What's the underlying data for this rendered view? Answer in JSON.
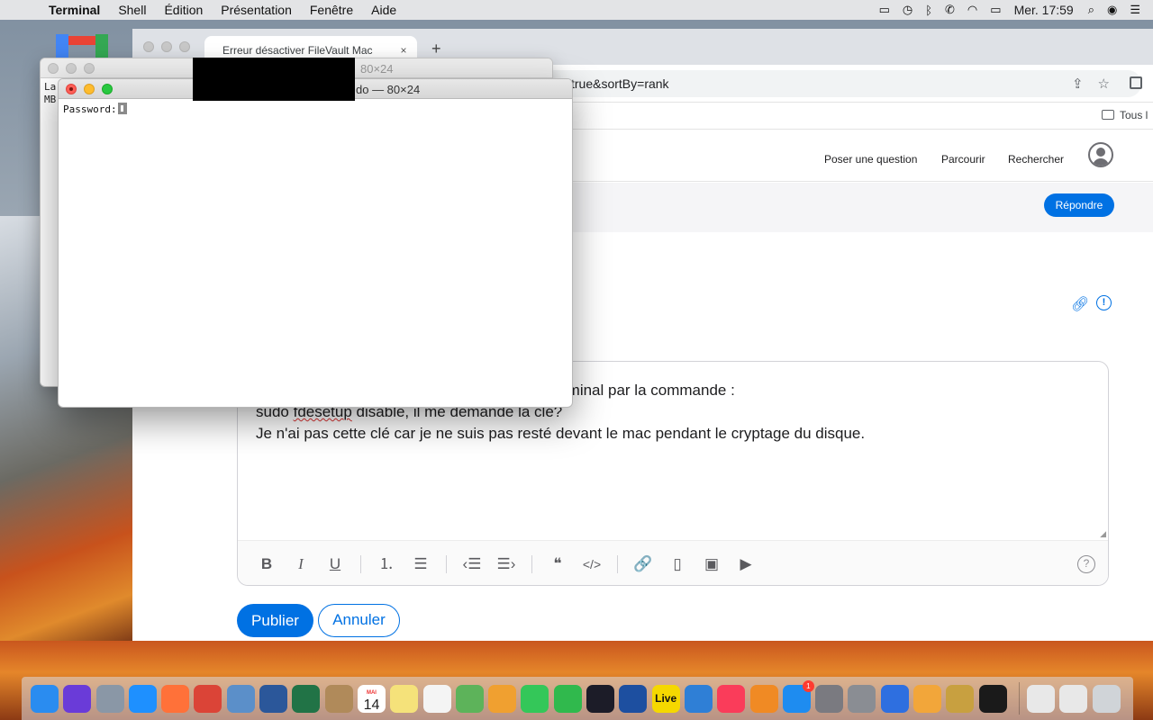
{
  "menubar": {
    "app": "Terminal",
    "items": [
      "Shell",
      "Édition",
      "Présentation",
      "Fenêtre",
      "Aide"
    ],
    "clock": "Mer. 17:59"
  },
  "browser": {
    "tab_title": "Erreur désactiver FileVault Mac",
    "tab_close": "×",
    "new_tab": "+",
    "url_visible": "true&sortBy=rank",
    "bookmarks_all": "Tous l",
    "nav": {
      "ask": "Poser une question",
      "browse": "Parcourir",
      "search": "Rechercher"
    },
    "reply_label": "Répondre"
  },
  "editor": {
    "line1": "rminal par la commande :",
    "line2_pre": "sudo ",
    "line2_typo": "fdesetup",
    "line2_post": " disable, il me demande la clé?",
    "line3": "Je n'ai pas cette clé car je ne suis pas resté devant le mac pendant le cryptage du disque.",
    "help": "?",
    "toolbar_icons": [
      "bold-icon",
      "italic-icon",
      "underline-icon",
      "ordered-list-icon",
      "bullet-list-icon",
      "outdent-icon",
      "indent-icon",
      "quote-icon",
      "code-icon",
      "link-icon",
      "page-icon",
      "image-icon",
      "video-icon"
    ],
    "tb": {
      "bold": "B",
      "italic": "I",
      "underline": "U",
      "olist": "⒈",
      "ulist": "☰",
      "outdent": "‹☰",
      "indent": "☰›",
      "quote": "❝",
      "code": "</>",
      "link": "🔗",
      "page": "▯",
      "image": "▣",
      "video": "▶"
    }
  },
  "actions": {
    "publish": "Publier",
    "cancel": "Annuler"
  },
  "terminal_back": {
    "title": "80×24",
    "line1": "La",
    "line2": "MB"
  },
  "terminal_front": {
    "title": "do — 80×24",
    "prompt": "Password:"
  },
  "dock": {
    "calendar_month": "MAI",
    "calendar_day": "14",
    "live_label": "Live",
    "appstore_badge": "1",
    "items": [
      {
        "name": "finder-icon",
        "color": "#2a8cf0"
      },
      {
        "name": "siri-icon",
        "color": "#6a3bd8"
      },
      {
        "name": "launchpad-icon",
        "color": "#8a97a6"
      },
      {
        "name": "safari-icon",
        "color": "#1e90ff"
      },
      {
        "name": "firefox-icon",
        "color": "#ff7139"
      },
      {
        "name": "chrome-icon",
        "color": "#db4437"
      },
      {
        "name": "preview-icon",
        "color": "#5b8fc9"
      },
      {
        "name": "word-icon",
        "color": "#2b579a"
      },
      {
        "name": "excel-icon",
        "color": "#217346"
      },
      {
        "name": "archive-icon",
        "color": "#b08a5a"
      },
      {
        "name": "calendar-icon",
        "color": "#ffffff"
      },
      {
        "name": "notes-icon",
        "color": "#f5e27a"
      },
      {
        "name": "reminders-icon",
        "color": "#f4f4f4"
      },
      {
        "name": "maps-icon",
        "color": "#5db35a"
      },
      {
        "name": "photos-icon",
        "color": "#f0a030"
      },
      {
        "name": "messages-icon",
        "color": "#34c759"
      },
      {
        "name": "facetime-icon",
        "color": "#30b94d"
      },
      {
        "name": "final-cut-icon",
        "color": "#1c1c28"
      },
      {
        "name": "app-blue-icon",
        "color": "#1d4fa0"
      },
      {
        "name": "live-icon",
        "color": "#f5d800"
      },
      {
        "name": "news-icon",
        "color": "#2f7fd6"
      },
      {
        "name": "music-icon",
        "color": "#fa3c5a"
      },
      {
        "name": "books-icon",
        "color": "#f08a24"
      },
      {
        "name": "app-store-icon",
        "color": "#1e8cf0"
      },
      {
        "name": "pro-display-icon",
        "color": "#7a7a80"
      },
      {
        "name": "system-preferences-icon",
        "color": "#8a8d93"
      },
      {
        "name": "s-app-icon",
        "color": "#2e6fe0"
      },
      {
        "name": "pages-icon",
        "color": "#f2a63a"
      },
      {
        "name": "keychain-icon",
        "color": "#c8a040"
      },
      {
        "name": "terminal-icon",
        "color": "#1a1a1a"
      },
      {
        "name": "document-icon",
        "color": "#e8e8e8"
      },
      {
        "name": "document-2-icon",
        "color": "#e8e8e8"
      },
      {
        "name": "trash-icon",
        "color": "#d0d4d8"
      }
    ]
  }
}
